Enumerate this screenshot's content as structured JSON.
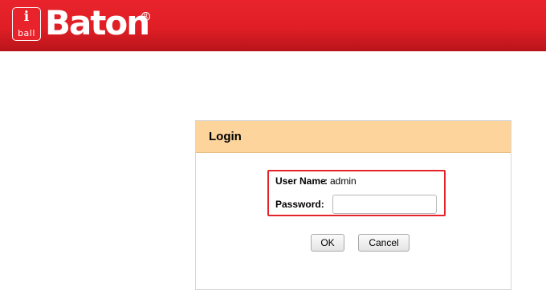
{
  "header": {
    "logo_small_top": "i",
    "logo_small_bottom": "ball",
    "brand": "Baton",
    "registered_mark": "R"
  },
  "login": {
    "title": "Login",
    "username_label": "User Name",
    "username_colon": ":",
    "username_value": "admin",
    "password_label": "Password:",
    "password_value": "",
    "ok_label": "OK",
    "cancel_label": "Cancel"
  },
  "colors": {
    "header_red": "#e8232b",
    "panel_header": "#fdd49c",
    "highlight_border": "#e3222a"
  }
}
